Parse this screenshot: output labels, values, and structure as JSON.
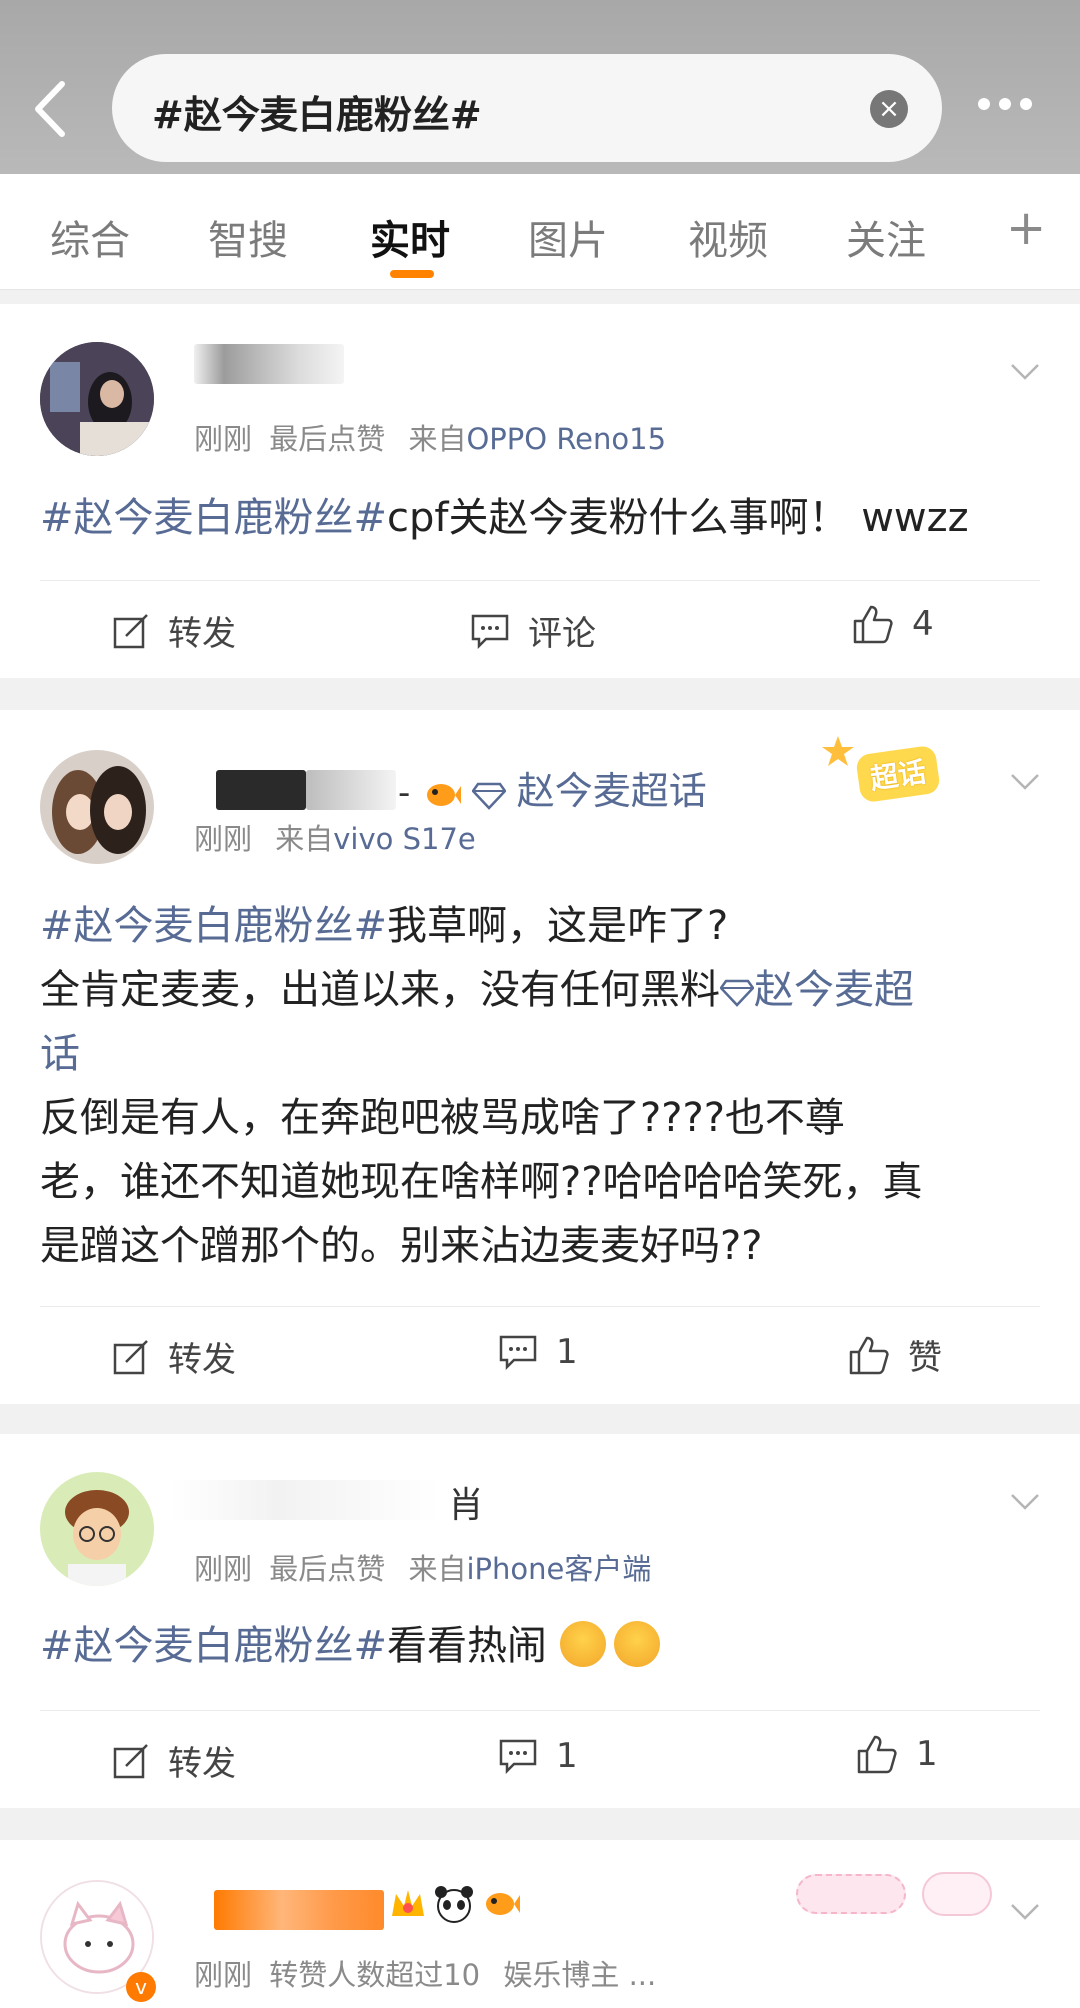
{
  "header": {
    "search_text": "#赵今麦白鹿粉丝#",
    "tabs": [
      "综合",
      "智搜",
      "实时",
      "图片",
      "视频",
      "关注"
    ],
    "active_tab": "实时",
    "plus_label": "+"
  },
  "colors": {
    "accent": "#ff8200",
    "link": "#576b95",
    "meta": "#8a8a8a"
  },
  "posts": [
    {
      "time": "刚刚",
      "extra": "最后点赞",
      "from_label": "来自",
      "source": "OPPO Reno15",
      "tag": "#赵今麦白鹿粉丝#",
      "text": "cpf关赵今麦粉什么事啊！ wwzz",
      "repost": "转发",
      "comment": "评论",
      "like": "4"
    },
    {
      "super_topic": "赵今麦超话",
      "super_badge": "超话",
      "time": "刚刚",
      "from_label": "来自",
      "source": "vivo S17e",
      "tag": "#赵今麦白鹿粉丝#",
      "line1": "我草啊，这是咋了?",
      "line2a": "全肯定麦麦，出道以来，没有任何黑料",
      "line2_topic": "赵今麦超",
      "line3": "话",
      "line4": "反倒是有人，在奔跑吧被骂成啥了????也不尊",
      "line5": "老，谁还不知道她现在啥样啊??哈哈哈哈笑死，真",
      "line6": "是蹭这个蹭那个的。别来沾边麦麦好吗??",
      "repost": "转发",
      "comment": "1",
      "like": "赞"
    },
    {
      "name_tail": "肖",
      "time": "刚刚",
      "extra": "最后点赞",
      "from_label": "来自",
      "source": "iPhone客户端",
      "tag": "#赵今麦白鹿粉丝#",
      "text": "看看热闹",
      "repost": "转发",
      "comment": "1",
      "like": "1"
    },
    {
      "time": "刚刚",
      "extra": "转赞人数超过10",
      "role": "娱乐博主 ..."
    }
  ]
}
